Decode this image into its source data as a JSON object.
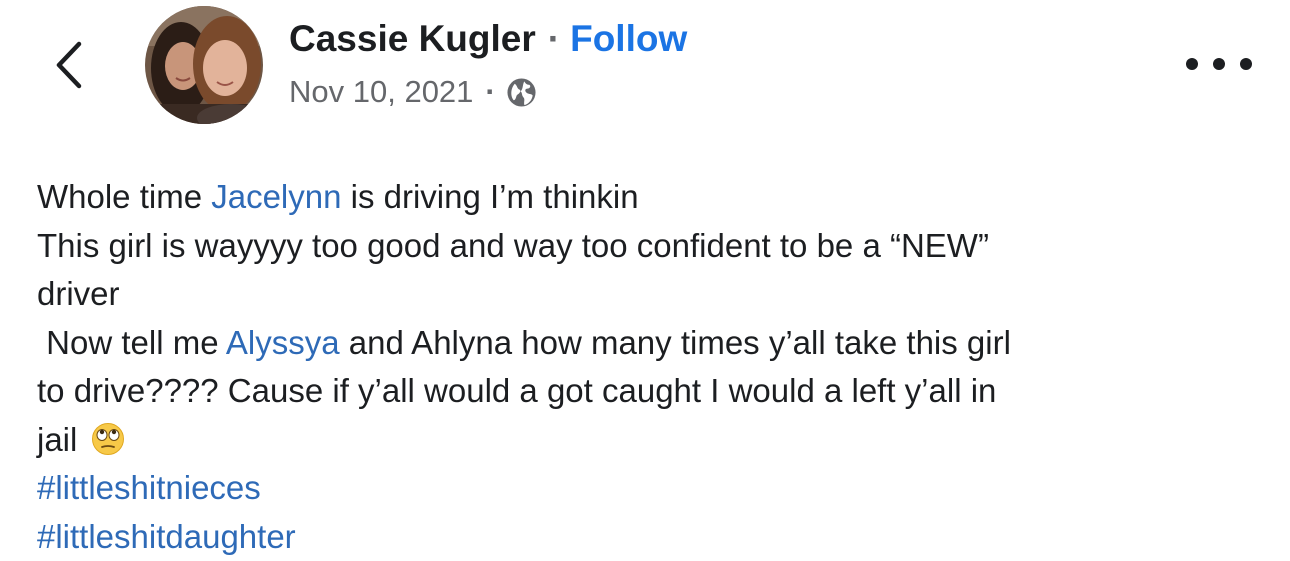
{
  "header": {
    "author_name": "Cassie Kugler",
    "separator": "·",
    "follow_label": "Follow",
    "date": "Nov 10, 2021",
    "meta_separator": "·",
    "privacy_icon": "globe-icon",
    "back_icon": "chevron-left-icon",
    "more_icon": "more-horizontal-icon"
  },
  "post": {
    "line1": {
      "before": "Whole time ",
      "mention": "Jacelynn",
      "after": " is driving I’m thinkin"
    },
    "line2": "This girl is wayyyy too good and way too confident to be a “NEW”",
    "line3": "driver",
    "line4": {
      "before": " Now tell me ",
      "mention": "Alyssya",
      "after": " and Ahlyna how many times y’all take this girl"
    },
    "line5": "to drive???? Cause if y’all would a got caught I would a left y’all in",
    "line6": {
      "text": "jail",
      "emoji": "eye-roll-emoji"
    },
    "hashtags": [
      "#littleshitnieces",
      "#littleshitdaughter"
    ]
  },
  "colors": {
    "link": "#2e6ab7",
    "follow": "#1b74e4",
    "meta": "#65676b",
    "text": "#1c1e21"
  }
}
